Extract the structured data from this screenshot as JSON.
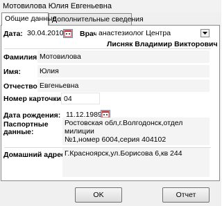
{
  "window": {
    "title": "Мотовилова Юлия Евгеньевна"
  },
  "tabs": [
    {
      "label": "Общие данные",
      "active": true
    },
    {
      "label": "Дополнительные сведения",
      "active": false
    }
  ],
  "form": {
    "date_label": "Дата:",
    "date_value": "30.04.2010",
    "doctor_label": "Врач",
    "doctor_specialty": "анастезиолог Центра",
    "doctor_name": "Лисняк Владимир Викторович",
    "surname_label": "Фамилия:",
    "surname_value": "Мотовилова",
    "name_label": "Имя:",
    "name_value": "Юлия",
    "patronymic_label": "Отчество",
    "patronymic_value": "Евгеньевна",
    "card_label": "Номер карточки:",
    "card_value": "04",
    "birth_label": "Дата рождения:",
    "birth_value": "11.12.1989",
    "passport_label_1": "Паспортные",
    "passport_label_2": "данные:",
    "passport_line_1": "Ростовская обл,г.Волгодонск,отдел милиции",
    "passport_line_2": "№1,номер 6004,серия 404102",
    "address_label": "Домашний адрес:",
    "address_value": "Г.Красноярск,ул.Борисова 6,кв 244"
  },
  "buttons": {
    "ok": "OK",
    "cancel": "Отчет"
  },
  "icons": {
    "calendar": "calendar-icon",
    "dropdown": "chevron-down-icon"
  }
}
